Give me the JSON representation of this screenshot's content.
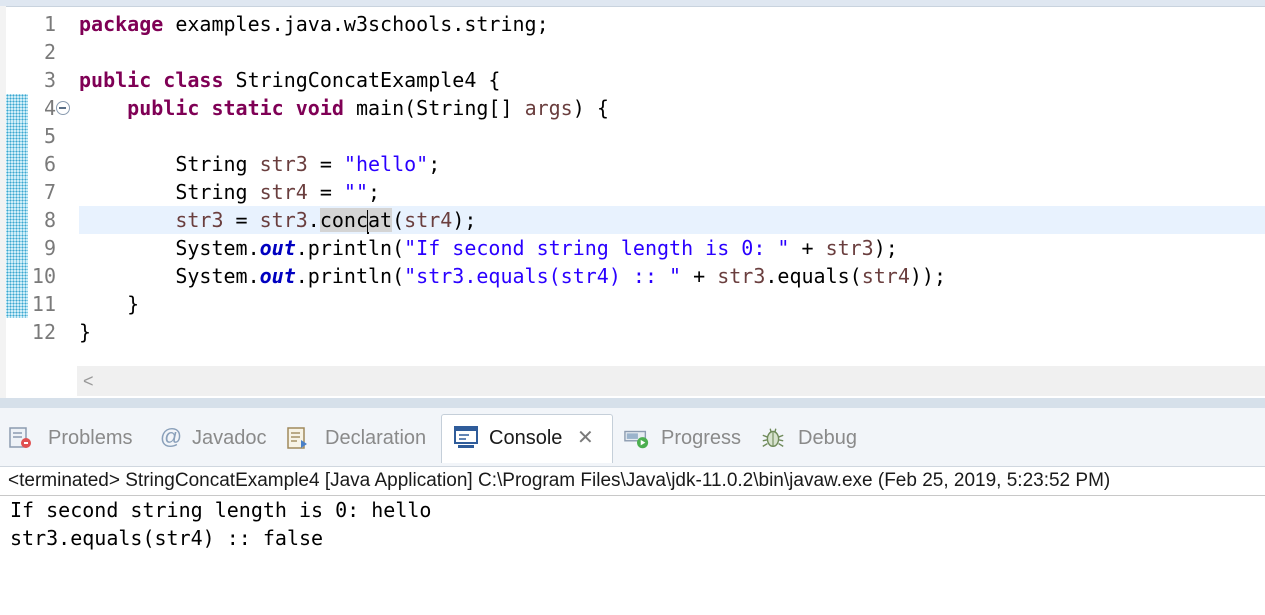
{
  "editor": {
    "lines": [
      {
        "num": "1",
        "tokens": [
          {
            "t": "package",
            "c": "kw"
          },
          {
            "t": " examples.java.w3schools.string;"
          }
        ]
      },
      {
        "num": "2",
        "tokens": []
      },
      {
        "num": "3",
        "tokens": [
          {
            "t": "public",
            "c": "kw"
          },
          {
            "t": " "
          },
          {
            "t": "class",
            "c": "kw"
          },
          {
            "t": " StringConcatExample4 {"
          }
        ]
      },
      {
        "num": "4",
        "tokens": [
          {
            "t": "    "
          },
          {
            "t": "public",
            "c": "kw"
          },
          {
            "t": " "
          },
          {
            "t": "static",
            "c": "kw"
          },
          {
            "t": " "
          },
          {
            "t": "void",
            "c": "kw"
          },
          {
            "t": " main(String[] "
          },
          {
            "t": "args",
            "c": "var"
          },
          {
            "t": ") {"
          }
        ]
      },
      {
        "num": "5",
        "tokens": []
      },
      {
        "num": "6",
        "tokens": [
          {
            "t": "        String "
          },
          {
            "t": "str3",
            "c": "var"
          },
          {
            "t": " = "
          },
          {
            "t": "\"hello\"",
            "c": "str"
          },
          {
            "t": ";"
          }
        ]
      },
      {
        "num": "7",
        "tokens": [
          {
            "t": "        String "
          },
          {
            "t": "str4",
            "c": "var"
          },
          {
            "t": " = "
          },
          {
            "t": "\"\"",
            "c": "str"
          },
          {
            "t": ";"
          }
        ]
      },
      {
        "num": "8",
        "tokens": [
          {
            "t": "        "
          },
          {
            "t": "str3",
            "c": "var"
          },
          {
            "t": " = "
          },
          {
            "t": "str3",
            "c": "var"
          },
          {
            "t": "."
          },
          {
            "t": "conc",
            "c": "occ"
          },
          {
            "caret": true
          },
          {
            "t": "at",
            "c": "occ"
          },
          {
            "t": "("
          },
          {
            "t": "str4",
            "c": "var"
          },
          {
            "t": ");"
          }
        ]
      },
      {
        "num": "9",
        "tokens": [
          {
            "t": "        System."
          },
          {
            "t": "out",
            "c": "static-field"
          },
          {
            "t": ".println("
          },
          {
            "t": "\"If second string length is 0: \"",
            "c": "str"
          },
          {
            "t": " + "
          },
          {
            "t": "str3",
            "c": "var"
          },
          {
            "t": ");"
          }
        ]
      },
      {
        "num": "10",
        "tokens": [
          {
            "t": "        System."
          },
          {
            "t": "out",
            "c": "static-field"
          },
          {
            "t": ".println("
          },
          {
            "t": "\"str3.equals(str4) :: \"",
            "c": "str"
          },
          {
            "t": " + "
          },
          {
            "t": "str3",
            "c": "var"
          },
          {
            "t": ".equals("
          },
          {
            "t": "str4",
            "c": "var"
          },
          {
            "t": "));"
          }
        ]
      },
      {
        "num": "11",
        "tokens": [
          {
            "t": "    }"
          }
        ]
      },
      {
        "num": "12",
        "tokens": [
          {
            "t": "}"
          }
        ]
      }
    ],
    "current_line": 8,
    "changed_lines": [
      4,
      5,
      6,
      7,
      8,
      9,
      10,
      11
    ],
    "folded_line": 4,
    "hscroll_left_glyph": "<"
  },
  "console": {
    "tabs": [
      {
        "label": "Problems",
        "icon": "problems-icon",
        "active": false
      },
      {
        "label": "Javadoc",
        "icon": "javadoc-icon",
        "active": false
      },
      {
        "label": "Declaration",
        "icon": "declaration-icon",
        "active": false
      },
      {
        "label": "Console",
        "icon": "console-icon",
        "active": true,
        "close": "✕"
      },
      {
        "label": "Progress",
        "icon": "progress-icon",
        "active": false
      },
      {
        "label": "Debug",
        "icon": "debug-icon",
        "active": false
      }
    ],
    "status": "<terminated> StringConcatExample4 [Java Application] C:\\Program Files\\Java\\jdk-11.0.2\\bin\\javaw.exe (Feb 25, 2019, 5:23:52 PM)",
    "output": [
      "If second string length is 0: hello",
      "str3.equals(str4) :: false"
    ]
  },
  "colors": {
    "keyword": "#7f0055",
    "string": "#2a00ff",
    "local_var": "#6a3e3e",
    "static_field": "#0000c0",
    "current_line": "#e8f2fe",
    "occurrence": "#d4d4d4"
  }
}
